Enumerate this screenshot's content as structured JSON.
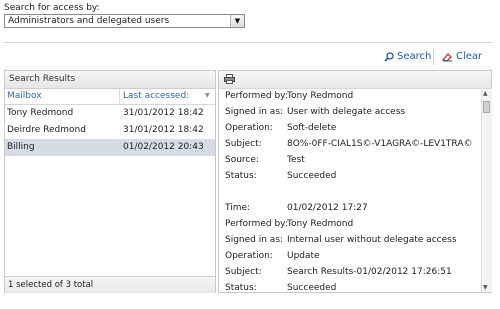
{
  "search": {
    "label": "Search for access by:",
    "selected": "Administrators and delegated users"
  },
  "actions": {
    "search_label": "Search",
    "clear_label": "Clear"
  },
  "results": {
    "title": "Search Results",
    "columns": [
      "Mailbox",
      "Last accessed:"
    ],
    "rows": [
      {
        "mailbox": "Tony Redmond",
        "last": "31/01/2012 18:42"
      },
      {
        "mailbox": "Deirdre Redmond",
        "last": "31/01/2012 18:42"
      },
      {
        "mailbox": "Billing",
        "last": "01/02/2012 20:43"
      }
    ],
    "footer": "1 selected of 3 total"
  },
  "details": {
    "entry1": {
      "performed_by_label": "Performed by:",
      "performed_by": "Tony Redmond",
      "signed_in_label": "Signed in as:",
      "signed_in": "User with delegate access",
      "operation_label": "Operation:",
      "operation": "Soft-delete",
      "subject_label": "Subject:",
      "subject": "8O%-0FF-CIAL1S©-V1AGRA©-LEV1TRA©",
      "source_label": "Source:",
      "source": "Test",
      "status_label": "Status:",
      "status": "Succeeded"
    },
    "entry2": {
      "time_label": "Time:",
      "time": "01/02/2012 17:27",
      "performed_by_label": "Performed by:",
      "performed_by": "Tony Redmond",
      "signed_in_label": "Signed in as:",
      "signed_in": "Internal user without delegate access",
      "operation_label": "Operation:",
      "operation": "Update",
      "subject_label": "Subject:",
      "subject": "Search Results-01/02/2012 17:26:51",
      "status_label": "Status:",
      "status": "Succeeded"
    }
  },
  "icons": {
    "search": "magnifier-icon",
    "clear": "clear-eraser-icon",
    "print": "printer-icon",
    "dropdown": "chevron-down-icon"
  },
  "colors": {
    "link": "#1f5aa8",
    "selected_row": "#d6dbe5",
    "clear_icon": "#c0392b"
  }
}
